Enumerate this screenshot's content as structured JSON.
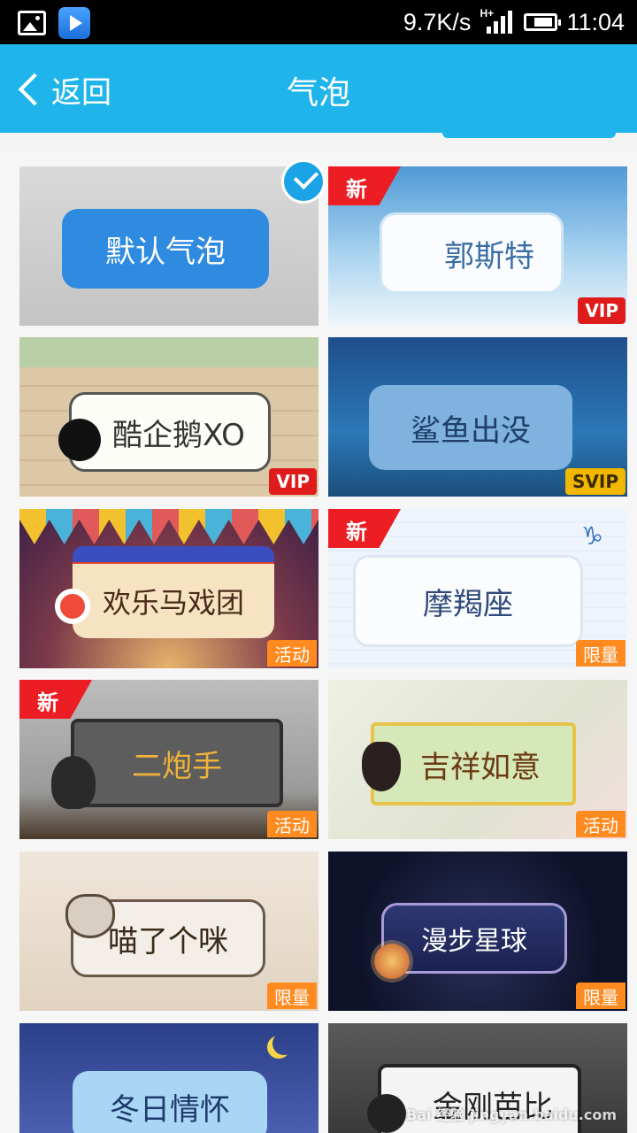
{
  "status_bar": {
    "speed": "9.7K/s",
    "network": "H+",
    "time": "11:04"
  },
  "header": {
    "back_label": "返回",
    "title": "气泡"
  },
  "bubbles": [
    {
      "label": "默认气泡",
      "badge_new": "",
      "badge": "",
      "badge_type": "",
      "selected": true
    },
    {
      "label": "郭斯特",
      "badge_new": "新",
      "badge": "VIP",
      "badge_type": "vip"
    },
    {
      "label": "酷企鹅XO",
      "badge_new": "",
      "badge": "VIP",
      "badge_type": "vip"
    },
    {
      "label": "鲨鱼出没",
      "badge_new": "",
      "badge": "SVIP",
      "badge_type": "svip"
    },
    {
      "label": "欢乐马戏团",
      "badge_new": "",
      "badge": "活动",
      "badge_type": "huodong"
    },
    {
      "label": "摩羯座",
      "badge_new": "新",
      "badge": "限量",
      "badge_type": "xianliang"
    },
    {
      "label": "二炮手",
      "badge_new": "新",
      "badge": "活动",
      "badge_type": "huodong"
    },
    {
      "label": "吉祥如意",
      "badge_new": "",
      "badge": "活动",
      "badge_type": "huodong"
    },
    {
      "label": "喵了个咪",
      "badge_new": "",
      "badge": "限量",
      "badge_type": "xianliang"
    },
    {
      "label": "漫步星球",
      "badge_new": "",
      "badge": "限量",
      "badge_type": "xianliang"
    },
    {
      "label": "冬日情怀",
      "badge_new": "",
      "badge": "",
      "badge_type": ""
    },
    {
      "label": "金刚芭比",
      "badge_new": "",
      "badge": "",
      "badge_type": ""
    }
  ],
  "watermark": "Bai 经验 jingyan.baidu.com"
}
